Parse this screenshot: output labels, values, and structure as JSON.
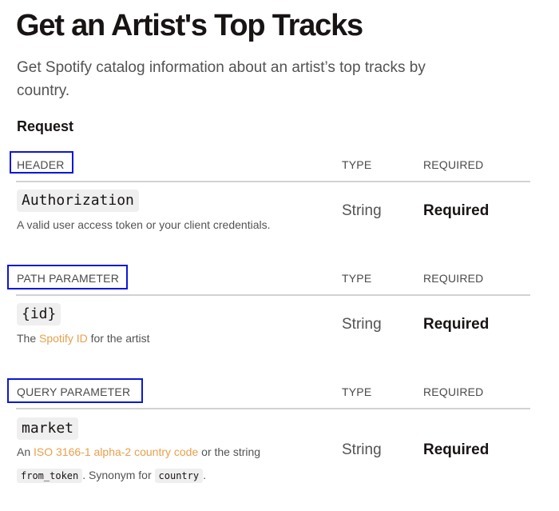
{
  "page": {
    "title": "Get an Artist's Top Tracks",
    "description": "Get Spotify catalog information about an artist’s top tracks by country."
  },
  "request": {
    "heading": "Request"
  },
  "columns": {
    "type": "TYPE",
    "required": "REQUIRED"
  },
  "header_section": {
    "label": "HEADER",
    "param": {
      "name": "Authorization",
      "description": "A valid user access token or your client credentials.",
      "type": "String",
      "required": "Required"
    }
  },
  "path_section": {
    "label": "PATH PARAMETER",
    "param": {
      "name": "{id}",
      "desc_prefix": "The ",
      "desc_link": "Spotify ID",
      "desc_suffix": " for the artist",
      "type": "String",
      "required": "Required"
    }
  },
  "query_section": {
    "label": "QUERY PARAMETER",
    "param": {
      "name": "market",
      "desc_prefix": "An ",
      "desc_link": "ISO 3166-1 alpha-2 country code",
      "desc_middle": " or the string",
      "desc_code1": "from_token",
      "desc_text2": ". Synonym for ",
      "desc_code2": "country",
      "desc_end": ".",
      "type": "String",
      "required": "Required"
    }
  },
  "colors": {
    "highlight_border": "#0a17d9",
    "link": "#e8a04c",
    "divider": "#d2d2d2",
    "code_background": "#efefef"
  }
}
